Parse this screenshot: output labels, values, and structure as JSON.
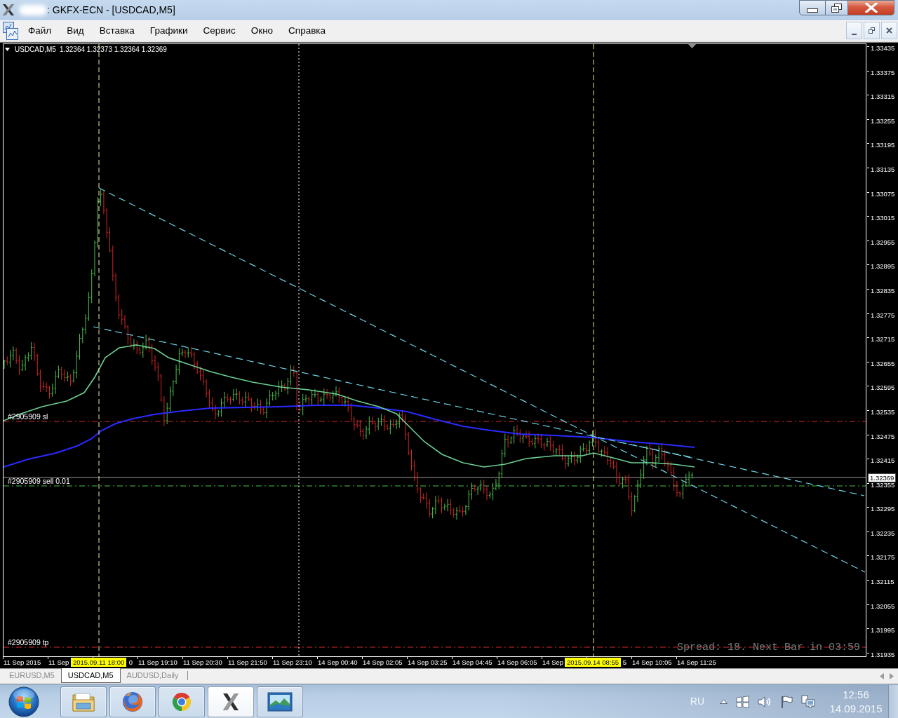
{
  "window": {
    "title": ": GKFX-ECN - [USDCAD,M5]"
  },
  "menu": {
    "items": [
      "Файл",
      "Вид",
      "Вставка",
      "Графики",
      "Сервис",
      "Окно",
      "Справка"
    ]
  },
  "chart": {
    "header": {
      "symbol": "USDCAD,M5",
      "quote": "1.32364 1.32373 1.32364 1.32369"
    },
    "price_axis": {
      "ticks": [
        "1.33435",
        "1.33375",
        "1.33315",
        "1.33255",
        "1.33195",
        "1.33135",
        "1.33075",
        "1.33015",
        "1.32955",
        "1.32895",
        "1.32835",
        "1.32775",
        "1.32715",
        "1.32655",
        "1.32595",
        "1.32535",
        "1.32475",
        "1.32415",
        "1.32355",
        "1.32295",
        "1.32235",
        "1.32175",
        "1.32115",
        "1.32055",
        "1.31995",
        "1.31935"
      ],
      "current_price": "1.32369"
    },
    "time_axis": {
      "labels": [
        {
          "kind": "plain",
          "text": "11 Sep 2015"
        },
        {
          "kind": "plain",
          "text": "11 Sep"
        },
        {
          "kind": "highlight",
          "text": "2015.09.11 18:00"
        },
        {
          "kind": "partial",
          "text": "0"
        },
        {
          "kind": "plain",
          "text": "11 Sep 19:10"
        },
        {
          "kind": "plain",
          "text": "11 Sep 20:30"
        },
        {
          "kind": "plain",
          "text": "11 Sep 21:50"
        },
        {
          "kind": "plain",
          "text": "11 Sep 23:10"
        },
        {
          "kind": "plain",
          "text": "14 Sep 00:40"
        },
        {
          "kind": "plain",
          "text": "14 Sep 02:05"
        },
        {
          "kind": "plain",
          "text": "14 Sep 03:25"
        },
        {
          "kind": "plain",
          "text": "14 Sep 04:45"
        },
        {
          "kind": "plain",
          "text": "14 Sep 06:05"
        },
        {
          "kind": "plain",
          "text": "14 Sep"
        },
        {
          "kind": "highlight",
          "text": "2015.09.14 08:55"
        },
        {
          "kind": "partial",
          "text": "5"
        },
        {
          "kind": "plain",
          "text": "14 Sep 10:05"
        },
        {
          "kind": "plain",
          "text": "14 Sep 11:25"
        }
      ]
    },
    "order_labels": [
      {
        "kind": "stop_loss",
        "text": "#2905909 sl"
      },
      {
        "kind": "open_order",
        "text": "#2905909 sell 0.01"
      },
      {
        "kind": "take_profit",
        "text": "#2905909 tp"
      }
    ],
    "status_text": "Spread: 18. Next Bar in 03:59"
  },
  "chart_tabs": [
    {
      "label": "EURUSD,M5",
      "selected": false
    },
    {
      "label": "USDCAD,M5",
      "selected": true
    },
    {
      "label": "AUDUSD,Daily",
      "selected": false
    }
  ],
  "taskbar": {
    "apps": [
      {
        "kind": "folder",
        "selected": false
      },
      {
        "kind": "globe",
        "selected": false
      },
      {
        "kind": "pinwheel",
        "selected": false
      },
      {
        "kind": "x_logo",
        "selected": true
      },
      {
        "kind": "picture",
        "selected": false
      }
    ],
    "language": "RU",
    "clock": {
      "time": "12:56",
      "date": "14.09.2015"
    }
  }
}
